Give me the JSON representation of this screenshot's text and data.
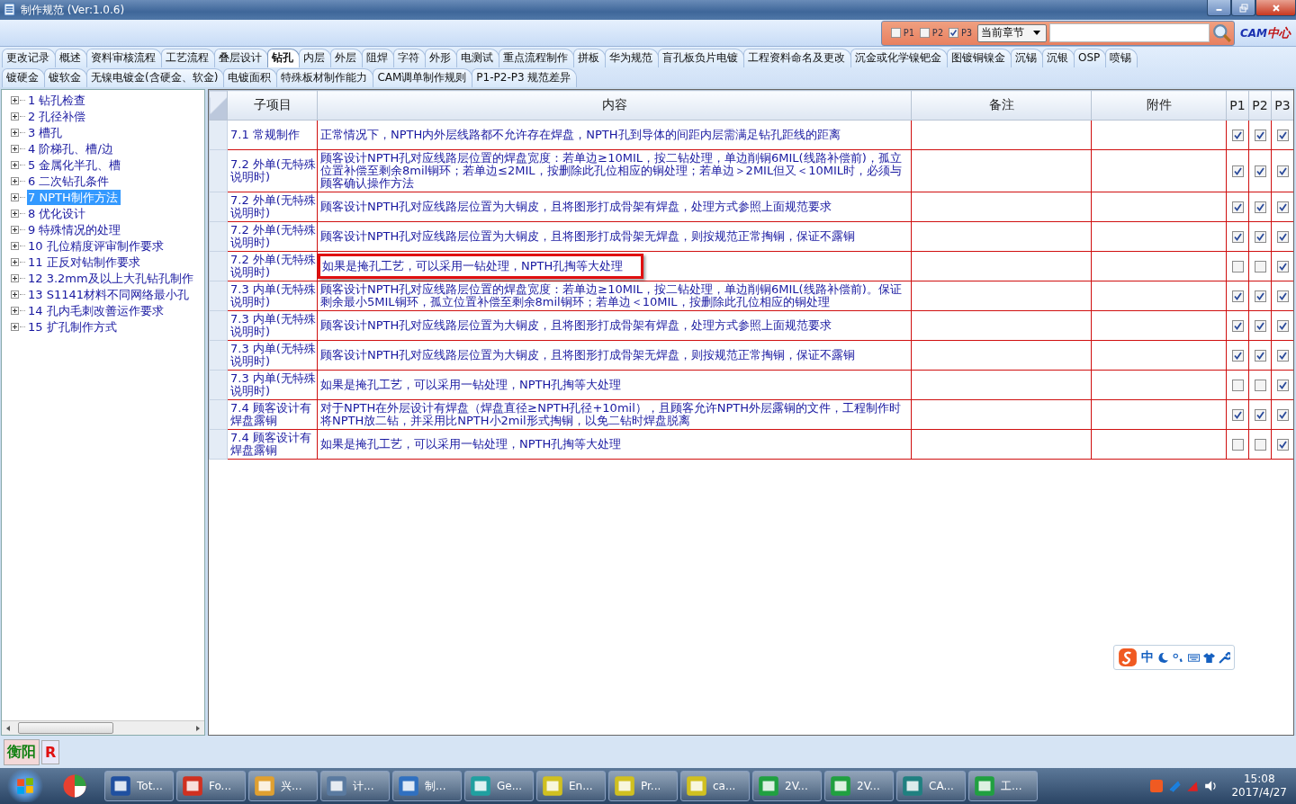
{
  "window": {
    "title": "制作规范 (Ver:1.0.6)"
  },
  "toolbar": {
    "filters": [
      {
        "label": "P1",
        "checked": false
      },
      {
        "label": "P2",
        "checked": false
      },
      {
        "label": "P3",
        "checked": true
      }
    ],
    "scope": "当前章节",
    "logo_a": "CAM",
    "logo_b": "中心"
  },
  "tab_rows": [
    [
      {
        "label": "更改记录",
        "selected": false
      },
      {
        "label": "概述",
        "selected": false
      },
      {
        "label": "资料审核流程",
        "selected": false
      },
      {
        "label": "工艺流程",
        "selected": false
      },
      {
        "label": "叠层设计",
        "selected": false
      },
      {
        "label": "钻孔",
        "selected": true
      },
      {
        "label": "内层",
        "selected": false
      },
      {
        "label": "外层",
        "selected": false
      },
      {
        "label": "阻焊",
        "selected": false
      },
      {
        "label": "字符",
        "selected": false
      },
      {
        "label": "外形",
        "selected": false
      },
      {
        "label": "电测试",
        "selected": false
      },
      {
        "label": "重点流程制作",
        "selected": false
      },
      {
        "label": "拼板",
        "selected": false
      },
      {
        "label": "华为规范",
        "selected": false
      },
      {
        "label": "盲孔板负片电镀",
        "selected": false
      },
      {
        "label": "工程资料命名及更改",
        "selected": false
      },
      {
        "label": "沉金或化学镍钯金",
        "selected": false
      },
      {
        "label": "图镀铜镍金",
        "selected": false
      },
      {
        "label": "沉锡",
        "selected": false
      },
      {
        "label": "沉银",
        "selected": false
      },
      {
        "label": "OSP",
        "selected": false
      },
      {
        "label": "喷锡",
        "selected": false
      }
    ],
    [
      {
        "label": "镀硬金",
        "selected": false
      },
      {
        "label": "镀软金",
        "selected": false
      },
      {
        "label": "无镍电镀金(含硬金、软金)",
        "selected": false
      },
      {
        "label": "电镀面积",
        "selected": false
      },
      {
        "label": "特殊板材制作能力",
        "selected": false
      },
      {
        "label": "CAM调单制作规则",
        "selected": false
      },
      {
        "label": "P1-P2-P3 规范差异",
        "selected": false
      }
    ]
  ],
  "tree": {
    "items": [
      {
        "label": "1 钻孔检查",
        "selected": false
      },
      {
        "label": "2 孔径补偿",
        "selected": false
      },
      {
        "label": "3 槽孔",
        "selected": false
      },
      {
        "label": "4 阶梯孔、槽/边",
        "selected": false
      },
      {
        "label": "5 金属化半孔、槽",
        "selected": false
      },
      {
        "label": "6 二次钻孔条件",
        "selected": false
      },
      {
        "label": "7 NPTH制作方法",
        "selected": true
      },
      {
        "label": "8 优化设计",
        "selected": false
      },
      {
        "label": "9 特殊情况的处理",
        "selected": false
      },
      {
        "label": "10 孔位精度评审制作要求",
        "selected": false
      },
      {
        "label": "11 正反对钻制作要求",
        "selected": false
      },
      {
        "label": "12 3.2mm及以上大孔钻孔制作",
        "selected": false
      },
      {
        "label": "13 S1141材料不同网络最小孔",
        "selected": false
      },
      {
        "label": "14 孔内毛刺改善运作要求",
        "selected": false
      },
      {
        "label": "15 扩孔制作方式",
        "selected": false
      }
    ]
  },
  "table": {
    "columns": [
      "子项目",
      "内容",
      "备注",
      "附件",
      "P1",
      "P2",
      "P3"
    ],
    "rows": [
      {
        "sub": "7.1 常规制作",
        "content": "正常情况下，NPTH内外层线路都不允许存在焊盘，NPTH孔到导体的间距内层需满足钻孔距线的距离",
        "p": [
          true,
          true,
          true
        ],
        "highlighted": false
      },
      {
        "sub": "7.2 外单(无特殊说明时)",
        "content": "顾客设计NPTH孔对应线路层位置的焊盘宽度：若单边≥10MIL，按二钻处理，单边削铜6MIL(线路补偿前)，孤立位置补偿至剩余8mil铜环；若单边≤2MIL，按删除此孔位相应的铜处理；若单边＞2MIL但又＜10MIL时，必须与顾客确认操作方法",
        "p": [
          true,
          true,
          true
        ],
        "highlighted": false
      },
      {
        "sub": "7.2 外单(无特殊说明时)",
        "content": "顾客设计NPTH孔对应线路层位置为大铜皮，且将图形打成骨架有焊盘，处理方式参照上面规范要求",
        "p": [
          true,
          true,
          true
        ],
        "highlighted": false
      },
      {
        "sub": "7.2 外单(无特殊说明时)",
        "content": "顾客设计NPTH孔对应线路层位置为大铜皮，且将图形打成骨架无焊盘，则按规范正常掏铜，保证不露铜",
        "p": [
          true,
          true,
          true
        ],
        "highlighted": false
      },
      {
        "sub": "7.2 外单(无特殊说明时)",
        "content": "如果是掩孔工艺，可以采用一钻处理，NPTH孔掏等大处理",
        "p": [
          false,
          false,
          true
        ],
        "highlighted": true
      },
      {
        "sub": "7.3 内单(无特殊说明时)",
        "content": "顾客设计NPTH孔对应线路层位置的焊盘宽度：若单边≥10MIL，按二钻处理，单边削铜6MIL(线路补偿前)。保证剩余最小5MIL铜环，孤立位置补偿至剩余8mil铜环；若单边＜10MIL，按删除此孔位相应的铜处理",
        "p": [
          true,
          true,
          true
        ],
        "highlighted": false
      },
      {
        "sub": "7.3 内单(无特殊说明时)",
        "content": "顾客设计NPTH孔对应线路层位置为大铜皮，且将图形打成骨架有焊盘，处理方式参照上面规范要求",
        "p": [
          true,
          true,
          true
        ],
        "highlighted": false
      },
      {
        "sub": "7.3 内单(无特殊说明时)",
        "content": "顾客设计NPTH孔对应线路层位置为大铜皮，且将图形打成骨架无焊盘，则按规范正常掏铜，保证不露铜",
        "p": [
          true,
          true,
          true
        ],
        "highlighted": false
      },
      {
        "sub": "7.3 内单(无特殊说明时)",
        "content": "如果是掩孔工艺，可以采用一钻处理，NPTH孔掏等大处理",
        "p": [
          false,
          false,
          true
        ],
        "highlighted": false
      },
      {
        "sub": "7.4 顾客设计有焊盘露铜",
        "content": "对于NPTH在外层设计有焊盘（焊盘直径≥NPTH孔径+10mil），且顾客允许NPTH外层露铜的文件，工程制作时将NPTH放二钻，并采用比NPTH小2mil形式掏铜，以免二钻时焊盘脱离",
        "p": [
          true,
          true,
          true
        ],
        "highlighted": false
      },
      {
        "sub": "7.4 顾客设计有焊盘露铜",
        "content": "如果是掩孔工艺，可以采用一钻处理，NPTH孔掏等大处理",
        "p": [
          false,
          false,
          true
        ],
        "highlighted": false
      }
    ]
  },
  "ime": {
    "label": "中"
  },
  "status_tags": [
    "衡阳",
    "R"
  ],
  "taskbar": {
    "items": [
      "Tot...",
      "Fo...",
      "兴...",
      "计...",
      "制...",
      "Ge...",
      "En...",
      "Pr...",
      "ca...",
      "2V...",
      "2V...",
      "CA...",
      "工..."
    ],
    "time": "15:08",
    "date": "2017/4/27"
  }
}
